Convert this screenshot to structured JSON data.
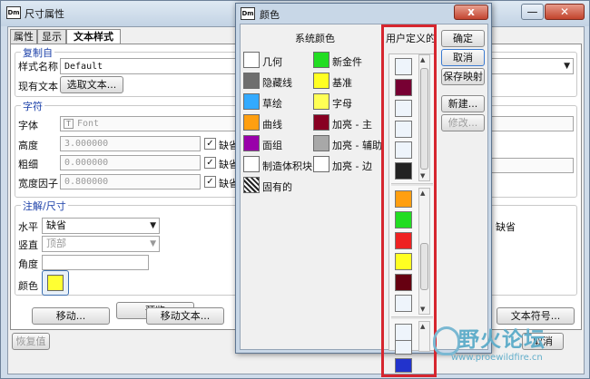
{
  "main_window": {
    "title": "尺寸属性",
    "app_icon_text": "Dm",
    "tabs": [
      "属性",
      "显示",
      "文本样式"
    ],
    "copy_from": {
      "title": "复制自",
      "style_name_label": "样式名称",
      "style_name_value": "Default",
      "existing_text_label": "现有文本",
      "select_text_button": "选取文本..."
    },
    "char": {
      "title": "字符",
      "font_label": "字体",
      "font_value": "Font",
      "height_label": "高度",
      "height_value": "3.000000",
      "thickness_label": "粗细",
      "thickness_value": "0.000000",
      "width_factor_label": "宽度因子",
      "width_factor_value": "0.800000",
      "default_label": "缺省"
    },
    "note": {
      "title": "注解/尺寸",
      "horizontal_label": "水平",
      "horizontal_value": "缺省",
      "vertical_label": "竖直",
      "vertical_value": "顶部",
      "angle_label": "角度",
      "color_label": "颜色",
      "color_value": "#ffff33",
      "right_value": "缺省"
    },
    "preview_button": "预览",
    "move_button": "移动...",
    "move_text_button": "移动文本...",
    "text_symbol_button": "文本符号...",
    "restore_button": "恢复值",
    "cancel_button": "取消"
  },
  "color_dialog": {
    "title": "颜色",
    "close_label": "x",
    "system_colors_title": "系统颜色",
    "user_defined_title": "用户定义的",
    "system_colors": [
      {
        "label": "几何",
        "color": "#ffffff"
      },
      {
        "label": "新金件",
        "color": "#22dd22"
      },
      {
        "label": "隐藏线",
        "color": "#6e6e6e"
      },
      {
        "label": "基准",
        "color": "#ffff22"
      },
      {
        "label": "草绘",
        "color": "#33aaff"
      },
      {
        "label": "字母",
        "color": "#ffff55"
      },
      {
        "label": "曲线",
        "color": "#ff9f10"
      },
      {
        "label": "加亮 - 主",
        "color": "#880022"
      },
      {
        "label": "面组",
        "color": "#9900aa"
      },
      {
        "label": "加亮 - 辅助",
        "color": "#a8a8a8"
      },
      {
        "label": "制造体积块",
        "color": "#ffffff"
      },
      {
        "label": "加亮 - 边",
        "color": "#ffffff"
      },
      {
        "label": "固有的",
        "color": "hatch"
      }
    ],
    "user_colors": [
      "#eef4fb",
      "#770033",
      "#eef4fb",
      "#eef4fb",
      "#eef4fb",
      "#222222",
      "#ff9f10",
      "#22dd22",
      "#ee2222",
      "#ffff22",
      "#660011",
      "#eef4fb",
      "#eef4fb",
      "#eef4fb",
      "#2233cc"
    ],
    "buttons": {
      "ok": "确定",
      "cancel": "取消",
      "save_map": "保存映射",
      "new": "新建...",
      "modify": "修改..."
    }
  },
  "watermark": {
    "text": "野火论坛",
    "url": "www.proewildfire.cn"
  }
}
